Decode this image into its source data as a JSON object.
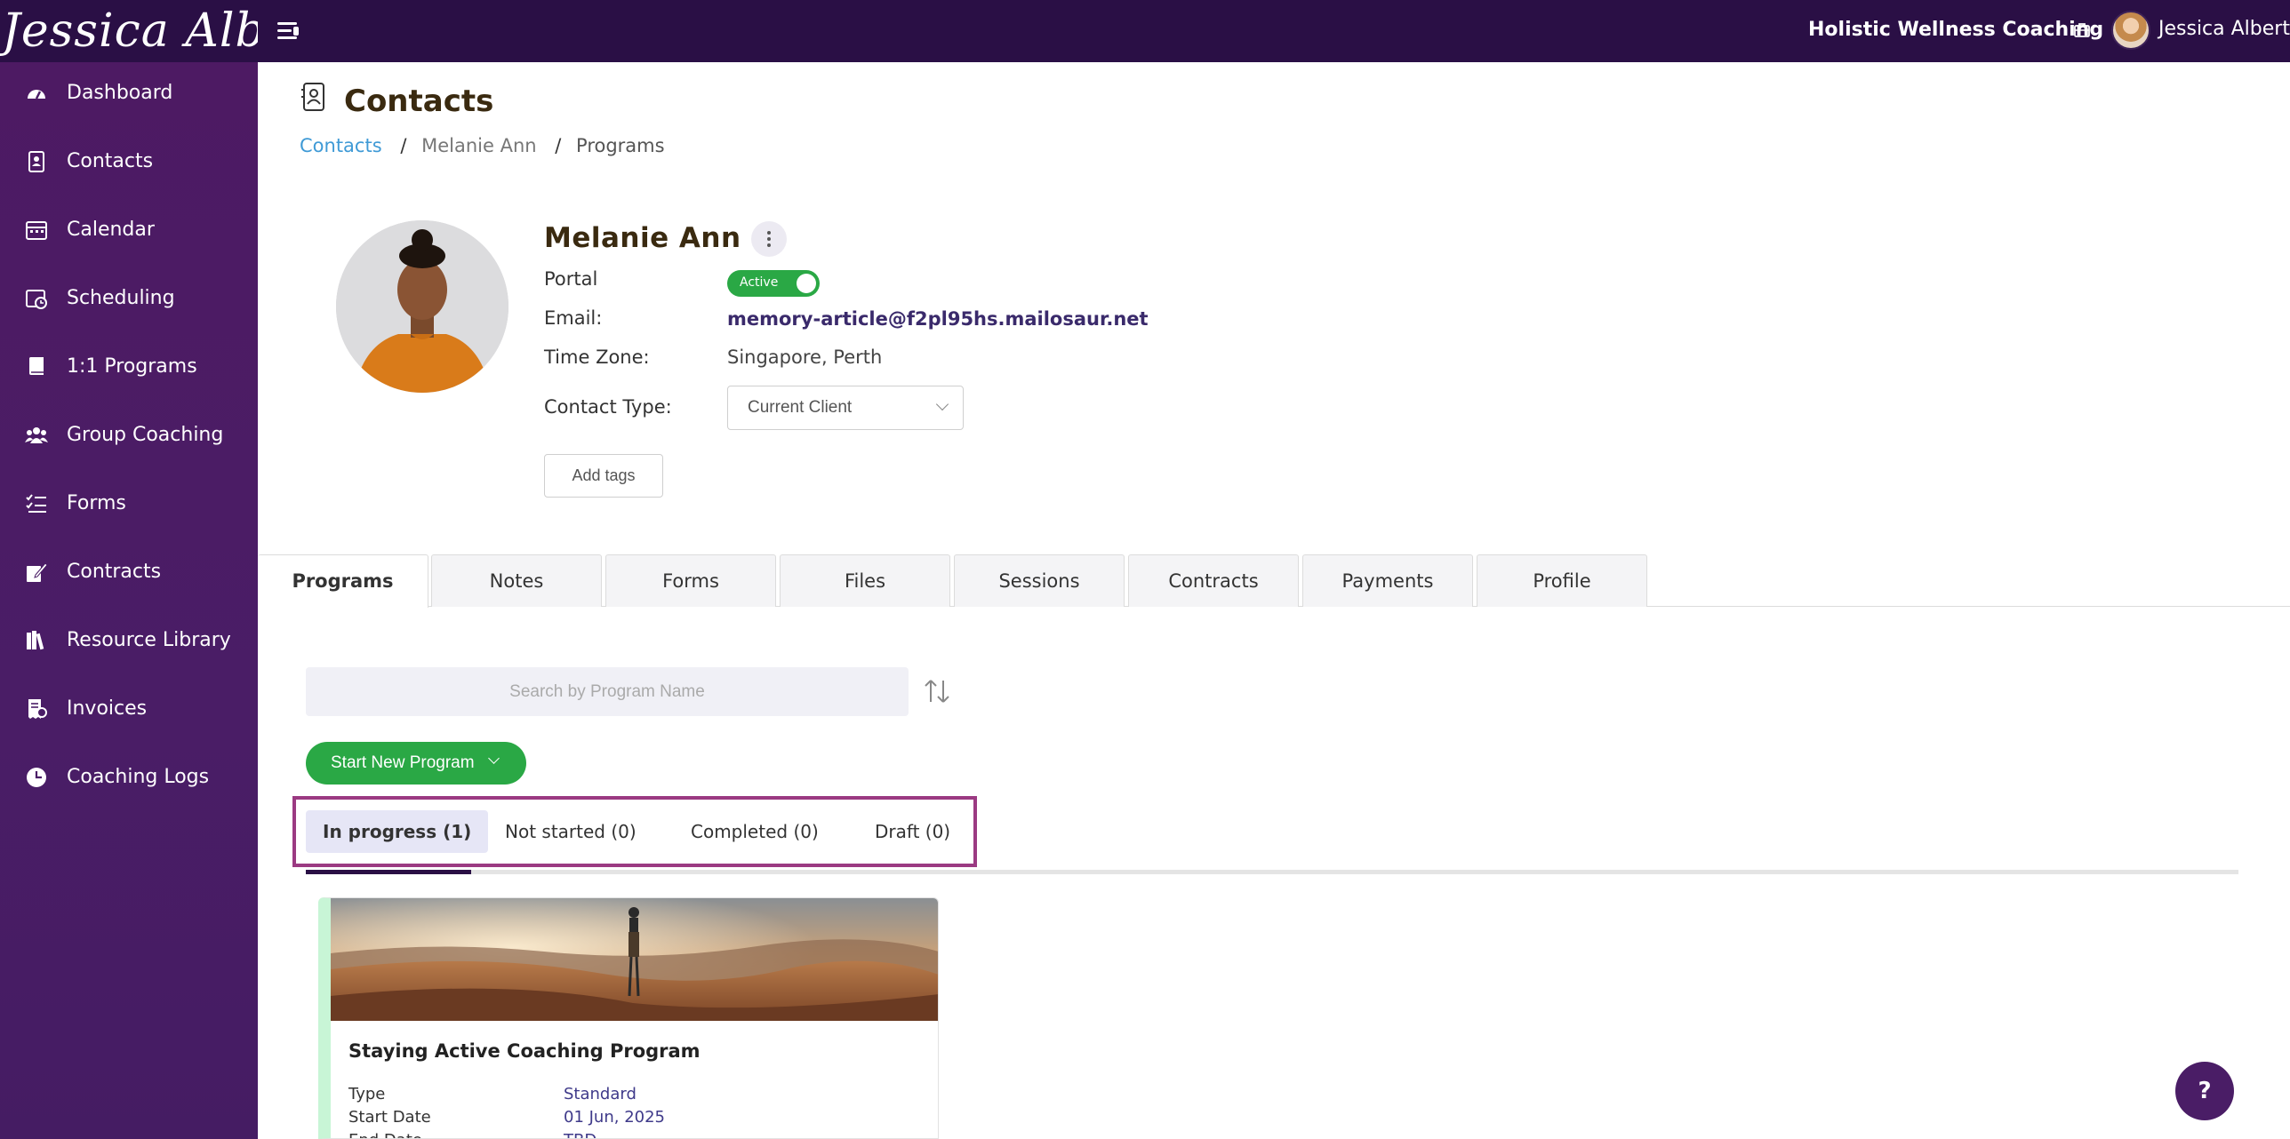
{
  "header": {
    "logo_text": "Jessica Albert",
    "business_name": "Holistic Wellness Coaching",
    "user_name": "Jessica Albert"
  },
  "sidebar": {
    "items": [
      {
        "label": "Dashboard",
        "icon": "dashboard-icon"
      },
      {
        "label": "Contacts",
        "icon": "contacts-icon"
      },
      {
        "label": "Calendar",
        "icon": "calendar-icon"
      },
      {
        "label": "Scheduling",
        "icon": "scheduling-icon"
      },
      {
        "label": "1:1 Programs",
        "icon": "book-icon"
      },
      {
        "label": "Group Coaching",
        "icon": "group-icon"
      },
      {
        "label": "Forms",
        "icon": "checklist-icon"
      },
      {
        "label": "Contracts",
        "icon": "signature-icon"
      },
      {
        "label": "Resource Library",
        "icon": "library-icon"
      },
      {
        "label": "Invoices",
        "icon": "invoice-icon"
      },
      {
        "label": "Coaching Logs",
        "icon": "clock-icon"
      }
    ]
  },
  "page": {
    "title": "Contacts",
    "breadcrumb": [
      "Contacts",
      "Melanie Ann",
      "Programs"
    ]
  },
  "contact": {
    "name": "Melanie Ann",
    "portal_label": "Portal",
    "portal_status": "Active",
    "email_label": "Email:",
    "email": "memory-article@f2pl95hs.mailosaur.net",
    "timezone_label": "Time Zone:",
    "timezone": "Singapore, Perth",
    "contact_type_label": "Contact Type:",
    "contact_type": "Current Client",
    "add_tags_label": "Add tags"
  },
  "tabs": [
    "Programs",
    "Notes",
    "Forms",
    "Files",
    "Sessions",
    "Contracts",
    "Payments",
    "Profile"
  ],
  "active_tab": "Programs",
  "programs": {
    "search_placeholder": "Search by Program Name",
    "start_button": "Start New Program",
    "filters": [
      "In progress (1)",
      "Not started (0)",
      "Completed (0)",
      "Draft (0)"
    ],
    "active_filter": "In progress (1)",
    "cards": [
      {
        "title": "Staying Active Coaching Program",
        "type_label": "Type",
        "type": "Standard",
        "start_label": "Start Date",
        "start": "01 Jun, 2025",
        "end_label": "End Date",
        "end": "TBD"
      }
    ]
  },
  "help_label": "?",
  "colors": {
    "topbar": "#2a0f45",
    "sidebar": "#4a1d66",
    "accent_green": "#2aa845",
    "link_blue": "#3f9ad6",
    "highlight_frame": "#9b3a82"
  }
}
